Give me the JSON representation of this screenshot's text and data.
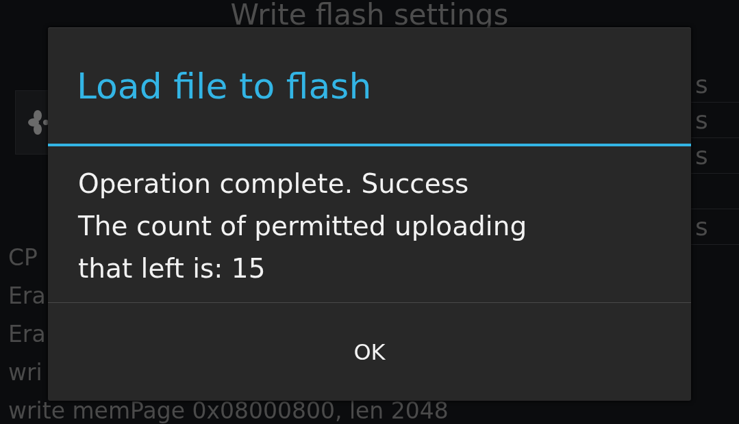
{
  "screen_title": "Write flash settings",
  "side_list": [
    {
      "kind": "text",
      "label": "s"
    },
    {
      "kind": "text",
      "label": "s"
    },
    {
      "kind": "text",
      "label": "s"
    },
    {
      "kind": "blank"
    },
    {
      "kind": "text",
      "label": "s"
    }
  ],
  "log_lines": [
    "CP",
    "Era",
    "Era",
    "wri",
    "write memPage 0x08000800, len 2048"
  ],
  "dialog": {
    "title": "Load file to flash",
    "message": [
      "Operation complete. Success",
      "The count of permitted uploading",
      "that left is: 15"
    ],
    "buttons": [
      "OK"
    ]
  }
}
